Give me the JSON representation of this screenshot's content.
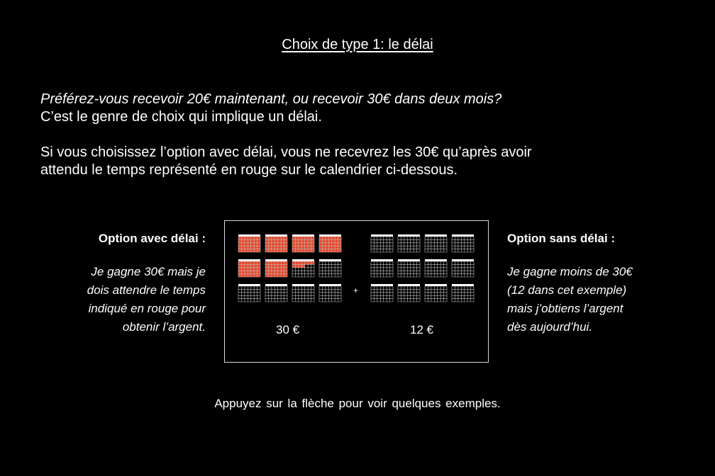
{
  "slide": {
    "title": "Choix de type 1: le délai",
    "question": "Préférez-vous recevoir 20€ maintenant, ou recevoir 30€ dans deux mois?",
    "line2": "C’est le genre de choix qui implique un délai.",
    "line3": "Si vous choisissez l’option avec délai, vous ne recevrez les 30€ qu’après avoir",
    "line4": "attendu le temps représenté en rouge sur le calendrier ci-dessous.",
    "footer": "Appuyez sur la flèche pour voir quelques exemples."
  },
  "option_delay": {
    "heading": "Option avec délai :",
    "lines": [
      "Je gagne 30€ mais je",
      "dois attendre le temps",
      "indiqué en rouge pour",
      "obtenir l’argent."
    ]
  },
  "option_nodelay": {
    "heading": "Option sans délai :",
    "lines": [
      "Je gagne moins de 30€",
      "(12 dans cet exemple)",
      "mais j’obtiens l’argent",
      "dès aujourd’hui."
    ]
  },
  "calendar": {
    "left_amount": "30 €",
    "right_amount": "12 €",
    "plus": "+",
    "red_color": "#e8472a",
    "delay_fill": [
      1,
      1,
      1,
      1,
      1,
      1,
      0.3,
      0,
      0,
      0,
      0,
      0
    ],
    "nodelay_fill": [
      0,
      0,
      0,
      0,
      0,
      0,
      0,
      0,
      0,
      0,
      0,
      0
    ]
  }
}
